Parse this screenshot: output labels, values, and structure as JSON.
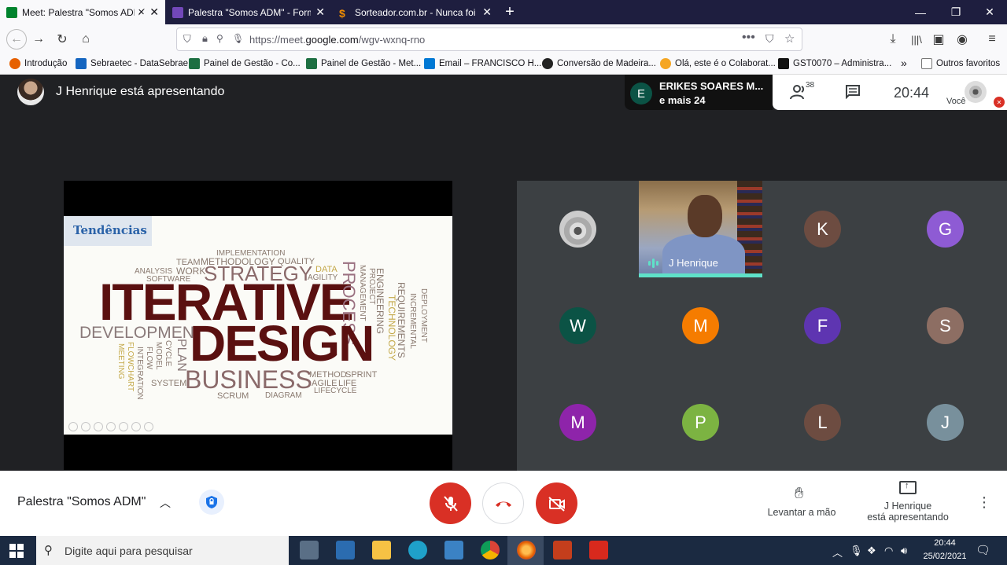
{
  "browser": {
    "tabs": [
      {
        "title": "Meet: Palestra \"Somos ADM\"",
        "active": true,
        "favicon": "google-meet-icon"
      },
      {
        "title": "Palestra \"Somos ADM\" - Form",
        "active": false,
        "favicon": "google-forms-icon"
      },
      {
        "title": "Sorteador.com.br - Nunca foi t",
        "active": false,
        "favicon": "sorteador-icon"
      }
    ],
    "new_tab": "+",
    "url_prefix": "https://meet.",
    "url_domain": "google.com",
    "url_path": "/wgv-wxnq-rno",
    "bookmarks": [
      {
        "label": "Introdução",
        "icon": "firefox-icon",
        "color": "#e66000"
      },
      {
        "label": "Sebraetec - DataSebrae",
        "icon": "chart-icon",
        "color": "#1565c0"
      },
      {
        "label": "Painel de Gestão - Co...",
        "icon": "excel-icon",
        "color": "#1d6f42"
      },
      {
        "label": "Painel de Gestão - Met...",
        "icon": "excel-icon",
        "color": "#1d6f42"
      },
      {
        "label": "Email – FRANCISCO H...",
        "icon": "outlook-icon",
        "color": "#0078d4"
      },
      {
        "label": "Conversão de Madeira...",
        "icon": "globe-icon",
        "color": "#222222"
      },
      {
        "label": "Olá, este é o Colaborat...",
        "icon": "link-icon",
        "color": "#f5a623"
      },
      {
        "label": "GST0070 – Administra...",
        "icon": "doc-icon",
        "color": "#111111"
      }
    ],
    "bookmarks_overflow": "»",
    "other_bookmarks": "Outros favoritos"
  },
  "meet": {
    "presenter_banner": "J Henrique está apresentando",
    "chip": {
      "initial": "E",
      "line1": "ERIKES SOARES M...",
      "line2": "e mais 24"
    },
    "people_count": "38",
    "clock": "20:44",
    "you_label": "Você",
    "slide": {
      "title": "Tendências",
      "words": {
        "iterative": "ITERATIVE",
        "design": "DESIGN",
        "strategy": "STRATEGY",
        "business": "BUSINESS",
        "development": "DEVELOPMENT",
        "process": "PROCESS",
        "implementation": "IMPLEMENTATION",
        "team": "TEAM",
        "methodology": "METHODOLOGY",
        "quality": "QUALITY",
        "analysis": "ANALYSIS",
        "work": "WORK",
        "software": "SOFTWARE",
        "data": "DATA",
        "agility": "AGILITY",
        "management": "MANAGEMENT",
        "project": "PROJECT",
        "engineering": "ENGINEERING",
        "technology": "TECHNOLOGY",
        "requirements": "REQUIREMENTS",
        "incremental": "INCREMENTAL",
        "deployment": "DEPLOYMENT",
        "meeting": "MEETING",
        "flowchart": "FLOWCHART",
        "integration": "INTEGRATION",
        "flow": "FLOW",
        "model": "MODEL",
        "cycle": "CYCLE",
        "plan": "PLAN",
        "system": "SYSTEM",
        "method": "METHOD",
        "sprint": "SPRINT",
        "agile": "AGILE",
        "life": "LIFE",
        "lifecycle": "LIFECYCLE",
        "scrum": "SCRUM",
        "diagram": "DIAGRAM"
      }
    },
    "speaker_name": "J Henrique",
    "grid": [
      {
        "initial": "",
        "color": "#cccccc",
        "kind": "koala"
      },
      {
        "initial": "",
        "color": "",
        "kind": "video"
      },
      {
        "initial": "K",
        "color": "#6d4c41"
      },
      {
        "initial": "G",
        "color": "#8e5bd4"
      },
      {
        "initial": "W",
        "color": "#0b5345"
      },
      {
        "initial": "M",
        "color": "#f57c00"
      },
      {
        "initial": "F",
        "color": "#5e35b1"
      },
      {
        "initial": "S",
        "color": "#8d6e63"
      },
      {
        "initial": "M",
        "color": "#8e24aa"
      },
      {
        "initial": "P",
        "color": "#7cb342"
      },
      {
        "initial": "L",
        "color": "#6d4c41"
      },
      {
        "initial": "J",
        "color": "#78909c"
      }
    ],
    "controls": {
      "meeting_title": "Palestra \"Somos ADM\"",
      "raise_hand": "Levantar a mão",
      "presenting_line1": "J Henrique",
      "presenting_line2": "está apresentando"
    }
  },
  "taskbar": {
    "search_placeholder": "Digite aqui para pesquisar",
    "time": "20:44",
    "date": "25/02/2021"
  }
}
